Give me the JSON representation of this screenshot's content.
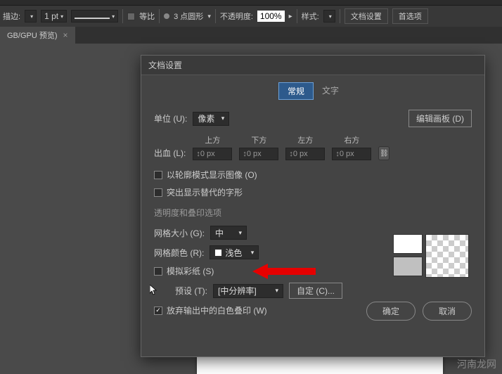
{
  "optionsBar": {
    "strokeLabel": "描边:",
    "strokeWidth": "1 pt",
    "uniformLabel": "等比",
    "pointsLabel": "3 点圆形",
    "opacityLabel": "不透明度:",
    "opacityValue": "100%",
    "styleLabel": "样式:",
    "docSetupBtn": "文档设置",
    "prefsBtn": "首选项"
  },
  "docTab": {
    "label": "GB/GPU 预览)",
    "close": "×"
  },
  "dialog": {
    "title": "文档设置",
    "tabs": {
      "general": "常规",
      "text": "文字"
    },
    "unitsLabel": "单位 (U):",
    "unitsValue": "像素",
    "editArtboardBtn": "编辑画板 (D)",
    "bleedLabel": "出血 (L):",
    "bleedHeaders": {
      "top": "上方",
      "bottom": "下方",
      "left": "左方",
      "right": "右方"
    },
    "bleedValues": {
      "top": "0 px",
      "bottom": "0 px",
      "left": "0 px",
      "right": "0 px"
    },
    "outlineModeLabel": "以轮廓模式显示图像 (O)",
    "highlightGlyphLabel": "突出显示替代的字形",
    "transparencySection": "透明度和叠印选项",
    "gridSizeLabel": "网格大小 (G):",
    "gridSizeValue": "中",
    "gridColorLabel": "网格颜色 (R):",
    "gridColorValue": "浅色",
    "simulatePaperLabel": "模拟彩纸 (S)",
    "presetLabel": "预设 (T):",
    "presetValue": "[中分辨率]",
    "customBtn": "自定 (C)...",
    "discardWhiteLabel": "放弃输出中的白色叠印 (W)",
    "okBtn": "确定",
    "cancelBtn": "取消"
  },
  "watermark": "河南龙网"
}
